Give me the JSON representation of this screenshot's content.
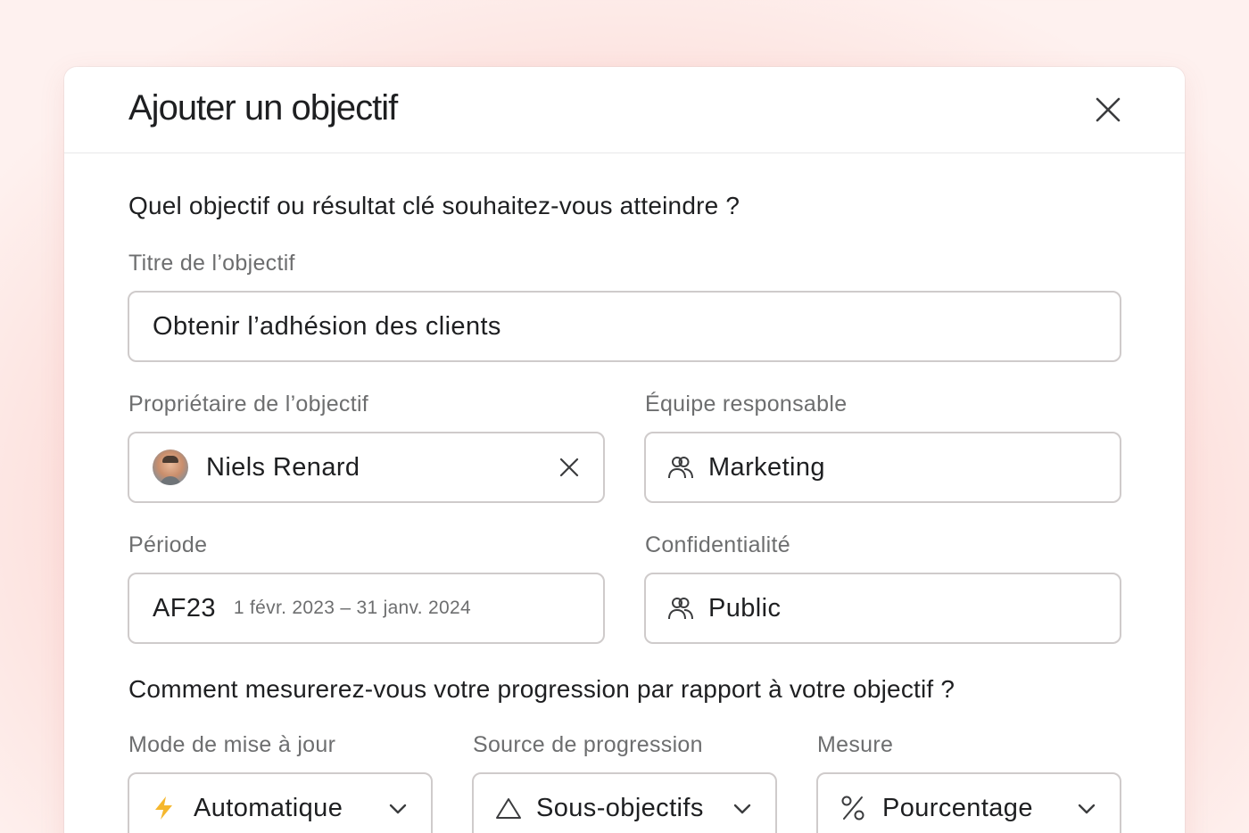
{
  "dialog": {
    "title": "Ajouter un objectif",
    "close_icon": "close-icon"
  },
  "section1": {
    "question": "Quel objectif ou résultat clé souhaitez-vous atteindre ?",
    "goal_title": {
      "label": "Titre de l’objectif",
      "value": "Obtenir l’adhésion des clients"
    },
    "owner": {
      "label": "Propriétaire de l’objectif",
      "value": "Niels Renard",
      "avatar_icon": "avatar",
      "clear_icon": "close-icon"
    },
    "team": {
      "label": "Équipe responsable",
      "value": "Marketing",
      "icon": "team-icon"
    },
    "period": {
      "label": "Période",
      "value": "AF23",
      "range": "1 févr. 2023 – 31 janv. 2024"
    },
    "privacy": {
      "label": "Confidentialité",
      "value": "Public",
      "icon": "team-icon"
    }
  },
  "section2": {
    "question": "Comment mesurerez-vous votre progression par rapport à votre objectif ?",
    "update_mode": {
      "label": "Mode de mise à jour",
      "value": "Automatique",
      "icon": "lightning-icon"
    },
    "progress_source": {
      "label": "Source de progression",
      "value": "Sous-objectifs",
      "icon": "triangle-icon"
    },
    "measure": {
      "label": "Mesure",
      "value": "Pourcentage",
      "icon": "percent-icon"
    }
  },
  "colors": {
    "accent_bolt": "#f5b72e",
    "border": "#cfcbcb",
    "label": "#6d6e6f",
    "text": "#1e1f21"
  }
}
